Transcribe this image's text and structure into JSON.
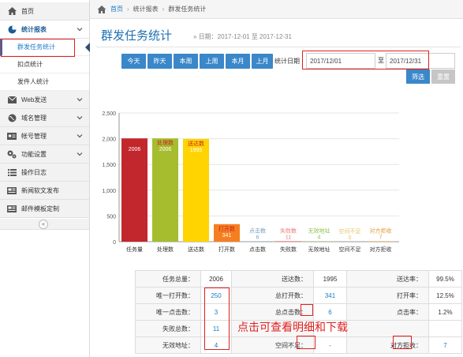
{
  "sidebar": {
    "home": "首页",
    "report": "统计报表",
    "sub": [
      "群发任务统计",
      "扣点统计",
      "发件人统计"
    ],
    "items": [
      "Web发送",
      "域名管理",
      "帐号管理",
      "功能设置",
      "操作日志",
      "新闻软文发布",
      "邮件模板定制"
    ],
    "collapse": "«"
  },
  "topbar": {
    "home": "首页",
    "crumb1": "统计报表",
    "crumb2": "群发任务统计"
  },
  "page": {
    "title": "群发任务统计",
    "subtitle": "» 日期：2017-12-01 至 2017-12-31"
  },
  "filters": {
    "quick": [
      "今天",
      "昨天",
      "本周",
      "上周",
      "本月",
      "上月"
    ],
    "date_label": "统计日期",
    "start": "2017/12/01",
    "sep": "至",
    "end": "2017/12/31",
    "filter": "筛选",
    "reset": "重置"
  },
  "chart_data": {
    "type": "bar",
    "categories": [
      "任务量",
      "处理数",
      "送达数",
      "打开数",
      "点击数",
      "失败数",
      "无效地址",
      "空间不足",
      "对方拒收"
    ],
    "values": [
      2006,
      2006,
      1995,
      341,
      6,
      11,
      4,
      0,
      7
    ],
    "colors": [
      "#c1272d",
      "#a6bd2e",
      "#ffd400",
      "#f57f20",
      "#7a9fbf",
      "#e77b7b",
      "#8bc34a",
      "#e8c46a",
      "#e09a3a"
    ],
    "ylim": [
      0,
      2500
    ],
    "yticks": [
      0,
      500,
      1000,
      1500,
      2000,
      2500
    ],
    "ytick_labels": [
      "0",
      "500",
      "1,000",
      "1,500",
      "2,000",
      "2,500"
    ]
  },
  "stats": [
    [
      "任务总量：",
      "2006",
      "送达数：",
      "1995",
      "送达率：",
      "99.5%"
    ],
    [
      "唯一打开数：",
      "250",
      "总打开数：",
      "341",
      "打开率：",
      "12.5%"
    ],
    [
      "唯一点击数：",
      "3",
      "总点击数：",
      "6",
      "点击率：",
      "1.2%"
    ],
    [
      "失败总数：",
      "11",
      "",
      "",
      "",
      ""
    ],
    [
      "无效地址：",
      "4",
      "空间不足：",
      "-",
      "对方拒收：",
      "7"
    ]
  ],
  "annotation": "点击可查看明细和下载"
}
